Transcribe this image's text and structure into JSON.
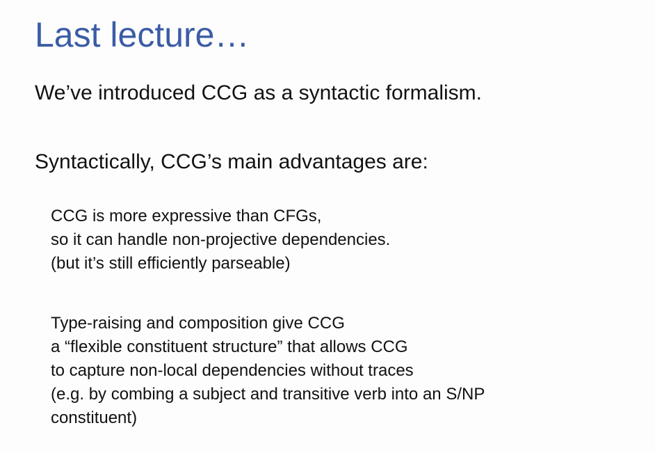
{
  "slide": {
    "title": "Last lecture…",
    "intro": "We’ve introduced CCG as a syntactic formalism.",
    "advantages_heading": "Syntactically, CCG’s main advantages are:",
    "points": [
      {
        "lines": [
          "CCG is more expressive than CFGs,",
          "so it can handle non-projective dependencies.",
          "(but it’s still efficiently parseable)"
        ]
      },
      {
        "lines": [
          "Type-raising and composition give CCG",
          "a “flexible constituent structure” that allows CCG",
          "to capture non-local dependencies without traces",
          "(e.g. by combing a subject and transitive verb into an S/NP",
          "constituent)"
        ]
      }
    ]
  },
  "colors": {
    "title": "#3b5ca6",
    "text": "#111111",
    "background": "#ffffff"
  }
}
